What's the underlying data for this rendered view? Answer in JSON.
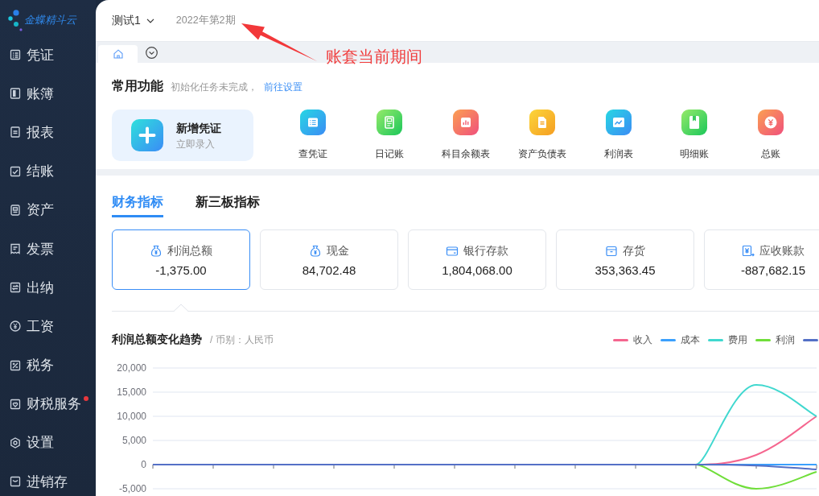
{
  "sidebar": {
    "logo": "金蝶精斗云",
    "items": [
      {
        "label": "凭证",
        "notification_dot": false
      },
      {
        "label": "账簿",
        "notification_dot": false
      },
      {
        "label": "报表",
        "notification_dot": false
      },
      {
        "label": "结账",
        "notification_dot": false
      },
      {
        "label": "资产",
        "notification_dot": false
      },
      {
        "label": "发票",
        "notification_dot": false
      },
      {
        "label": "出纳",
        "notification_dot": false
      },
      {
        "label": "工资",
        "notification_dot": false
      },
      {
        "label": "税务",
        "notification_dot": false
      },
      {
        "label": "财税服务",
        "notification_dot": true
      },
      {
        "label": "设置",
        "notification_dot": false
      },
      {
        "label": "进销存",
        "notification_dot": false
      }
    ]
  },
  "header": {
    "account": "测试1",
    "period": "2022年第2期"
  },
  "annotation": {
    "text": "账套当前期间"
  },
  "page_tabs": [
    {
      "kind": "home",
      "selected": true
    }
  ],
  "shortcuts": {
    "title": "常用功能",
    "notice": "初始化任务未完成，",
    "link": "前往设置",
    "primary": {
      "title": "新增凭证",
      "subtitle": "立即录入"
    },
    "items": [
      {
        "label": "查凭证"
      },
      {
        "label": "日记账"
      },
      {
        "label": "科目余额表"
      },
      {
        "label": "资产负债表"
      },
      {
        "label": "利润表"
      },
      {
        "label": "明细账"
      },
      {
        "label": "总账"
      }
    ]
  },
  "indicators": {
    "tabs": [
      {
        "label": "财务指标",
        "selected": true
      },
      {
        "label": "新三板指标",
        "selected": false
      }
    ],
    "cards": [
      {
        "label": "利润总额",
        "value": "-1,375.00",
        "selected": true
      },
      {
        "label": "现金",
        "value": "84,702.48",
        "selected": false
      },
      {
        "label": "银行存款",
        "value": "1,804,068.00",
        "selected": false
      },
      {
        "label": "存货",
        "value": "353,363.45",
        "selected": false
      },
      {
        "label": "应收账款",
        "value": "-887,682.15",
        "selected": false
      }
    ]
  },
  "chart": {
    "title": "利润总额变化趋势",
    "currency": "/ 币别：人民币",
    "chart_data": {
      "type": "line",
      "grid": true,
      "ylim": [
        -5000,
        20000
      ],
      "yticks": [
        {
          "value": -5000,
          "label": "-5,000"
        },
        {
          "value": 0,
          "label": "0"
        },
        {
          "value": 5000,
          "label": "5,000"
        },
        {
          "value": 10000,
          "label": "10,000"
        },
        {
          "value": 15000,
          "label": "15,000"
        },
        {
          "value": 20000,
          "label": "20,000"
        }
      ],
      "series": [
        {
          "name": "收入",
          "color": "#f5668f",
          "values": [
            null,
            null,
            null,
            null,
            null,
            null,
            null,
            null,
            null,
            0,
            2000,
            10000
          ]
        },
        {
          "name": "成本",
          "color": "#3ba0fd",
          "values": [
            null,
            null,
            null,
            null,
            null,
            null,
            null,
            null,
            null,
            0,
            0,
            0
          ]
        },
        {
          "name": "费用",
          "color": "#40d8cf",
          "values": [
            null,
            null,
            null,
            null,
            null,
            null,
            null,
            null,
            null,
            0,
            16500,
            10000
          ]
        },
        {
          "name": "利润",
          "color": "#70de3a",
          "values": [
            null,
            null,
            null,
            null,
            null,
            null,
            null,
            null,
            null,
            0,
            -5000,
            -1500
          ]
        },
        {
          "color": "#5470c6",
          "values": [
            0,
            0,
            0,
            0,
            0,
            0,
            0,
            0,
            0,
            0,
            -200,
            -1000
          ]
        }
      ]
    }
  }
}
